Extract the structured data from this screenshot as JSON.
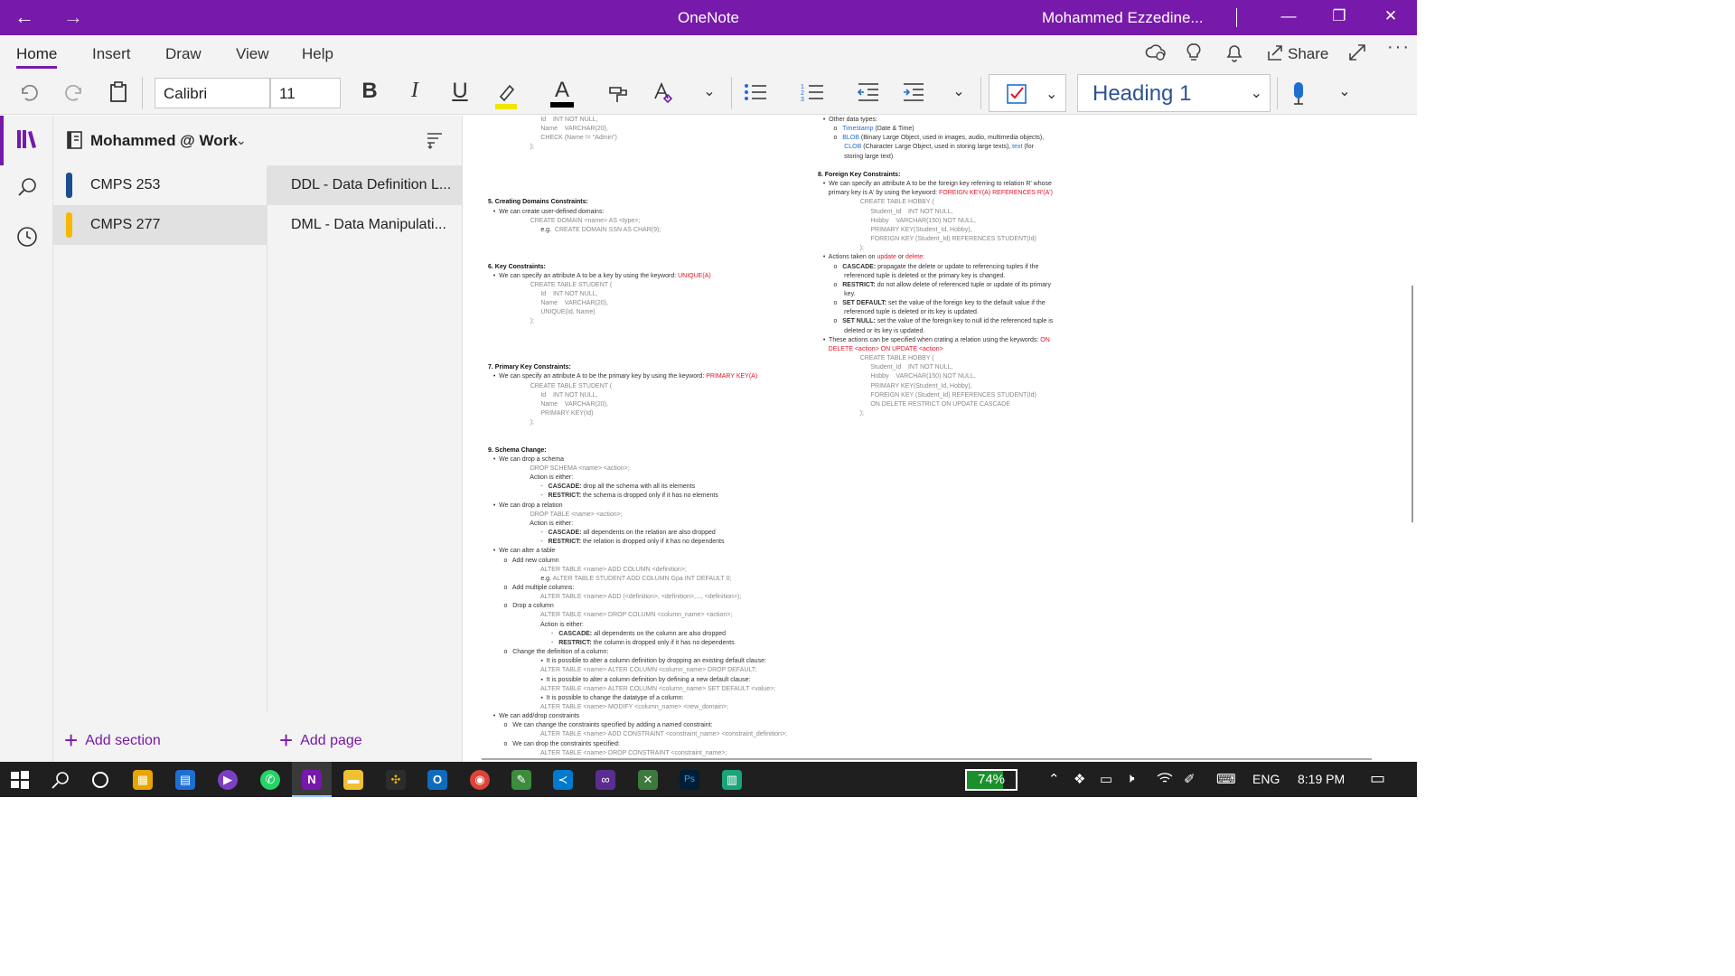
{
  "titlebar": {
    "back_icon": "←",
    "forward_icon": "→",
    "app_title": "OneNote",
    "user_name": "Mohammed Ezzedine...",
    "minimize": "—",
    "restore": "❐",
    "close": "✕",
    "bg_color": "#7719aa"
  },
  "tabs": [
    {
      "label": "Home",
      "active": true
    },
    {
      "label": "Insert"
    },
    {
      "label": "Draw"
    },
    {
      "label": "View"
    },
    {
      "label": "Help"
    }
  ],
  "tab_actions": {
    "share_label": "Share"
  },
  "ribbon": {
    "font_name": "Calibri",
    "font_size": "11",
    "bold": "B",
    "italic": "I",
    "underline": "U",
    "font_color_letter": "A",
    "style_value": "Heading 1"
  },
  "notebook": {
    "name": "Mohammed @ Work"
  },
  "sections": [
    {
      "label": "CMPS 253",
      "color": "#1e4e8c",
      "selected": false
    },
    {
      "label": "CMPS 277",
      "color": "#f5b800",
      "selected": true
    }
  ],
  "pages": [
    {
      "label": "DDL - Data Definition L...",
      "selected": true
    },
    {
      "label": "DML - Data Manipulati...",
      "selected": false
    }
  ],
  "add_section_label": "Add section",
  "add_page_label": "Add page",
  "taskbar": {
    "battery": "74%",
    "battery_level": 0.74,
    "language": "ENG",
    "time": "8:19 PM"
  }
}
